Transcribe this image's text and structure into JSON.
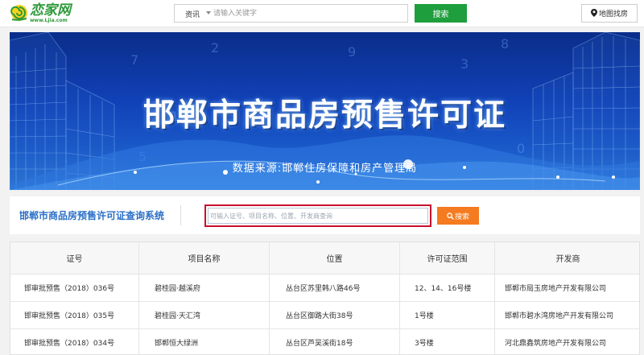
{
  "header": {
    "logo_text": "恋家网",
    "logo_url": "www.Ljia.com",
    "search_category": "资讯",
    "search_placeholder": "请输入关键字",
    "search_button": "搜索",
    "map_button": "地图找房"
  },
  "banner": {
    "title": "邯郸市商品房预售许可证",
    "subtitle": "数据来源:邯郸住房保障和房产管理局"
  },
  "query": {
    "label": "邯郸市商品房预售许可证查询系统",
    "placeholder": "可输入证号、项目名称、位置、开发商查询",
    "button": "搜索"
  },
  "table": {
    "headers": [
      "证号",
      "项目名称",
      "位置",
      "许可证范围",
      "开发商"
    ],
    "rows": [
      [
        "邯审批预售（2018）036号",
        "碧桂园·越溪府",
        "丛台区苏里韩八路46号",
        "12、14、16号楼",
        "邯郸市局玉房地产开发有限公司"
      ],
      [
        "邯审批预售（2018）035号",
        "碧桂园·天汇湾",
        "丛台区御路大街38号",
        "1号楼",
        "邯郸市碧水湾房地产开发有限公司"
      ],
      [
        "邯审批预售（2018）034号",
        "邯郸恒大绿洲",
        "丛台区芦吴溪街18号",
        "3号楼",
        "河北鼎鑫筑房地产开发有限公司"
      ]
    ]
  },
  "colors": {
    "brand_green": "#1f9e3d",
    "query_orange": "#f57b20",
    "highlight_red": "#c8102e",
    "banner_blue": "#1142b8"
  }
}
